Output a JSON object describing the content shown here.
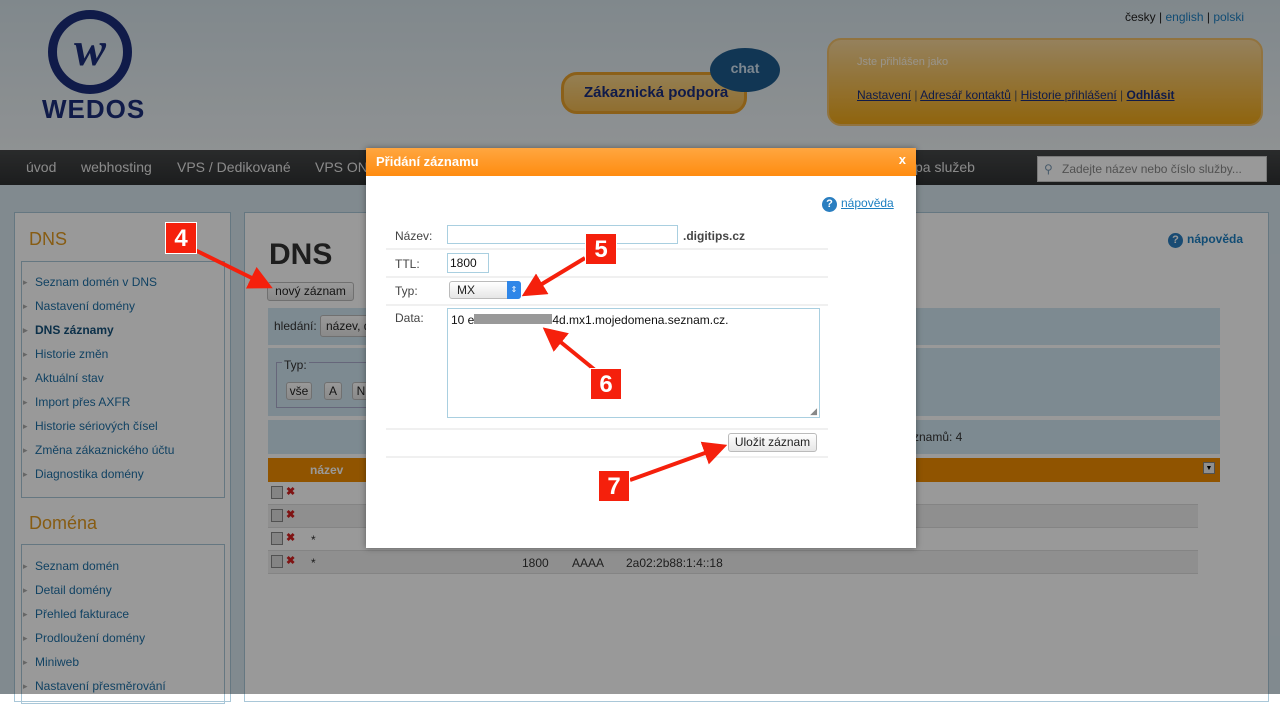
{
  "header": {
    "logo_text": "WEDOS",
    "support_button": "Zákaznická podpora",
    "chat_label": "chat",
    "languages": [
      "česky",
      "english",
      "polski"
    ],
    "logged_in_label": "Jste přihlášen jako",
    "user_links": [
      "Nastavení",
      "Adresář kontaktů",
      "Historie přihlášení",
      "Odhlásit"
    ]
  },
  "nav": {
    "items": [
      "úvod",
      "webhosting",
      "VPS / Dedikované",
      "VPS ON",
      "pa služeb"
    ],
    "search_placeholder": "Zadejte název nebo číslo služby..."
  },
  "sidebar": {
    "dns_title": "DNS",
    "dns_items": [
      "Seznam domén v DNS",
      "Nastavení domény",
      "DNS záznamy",
      "Historie změn",
      "Aktuální stav",
      "Import přes AXFR",
      "Historie sériových čísel",
      "Změna zákaznického účtu",
      "Diagnostika domény"
    ],
    "domain_title": "Doména",
    "domain_items": [
      "Seznam domén",
      "Detail domény",
      "Přehled fakturace",
      "Prodloužení domény",
      "Miniweb",
      "Nastavení přesměrování"
    ]
  },
  "main": {
    "title": "DNS",
    "new_record_button": "nový záznam",
    "help_label": "nápověda",
    "search_label": "hledání:",
    "search_value": "název, d",
    "type_legend": "Typ:",
    "type_buttons": [
      "vše",
      "A",
      "N"
    ],
    "records_count": "znamů: 4",
    "table_header": "název",
    "rows": [
      {
        "name": "",
        "ttl": "",
        "type": "",
        "data": ""
      },
      {
        "name": "",
        "ttl": "",
        "type": "",
        "data": ""
      },
      {
        "name": "*",
        "ttl": "",
        "type": "",
        "data": ""
      },
      {
        "name": "*",
        "ttl": "1800",
        "type": "AAAA",
        "data": "2a02:2b88:1:4::18"
      }
    ]
  },
  "dialog": {
    "title": "Přidání záznamu",
    "close": "x",
    "help": "nápověda",
    "name_label": "Název:",
    "name_value": "",
    "domain_suffix": ".digitips.cz",
    "ttl_label": "TTL:",
    "ttl_value": "1800",
    "type_label": "Typ:",
    "type_value": "MX",
    "data_label": "Data:",
    "data_prefix": "10 e",
    "data_suffix": "4d.mx1.mojedomena.seznam.cz.",
    "save_button": "Uložit záznam"
  },
  "annotations": [
    "4",
    "5",
    "6",
    "7"
  ],
  "colors": {
    "accent": "#ff8c10",
    "annotation": "#f5200c",
    "link": "#1d7fc1",
    "brand": "#1c2e7a"
  }
}
